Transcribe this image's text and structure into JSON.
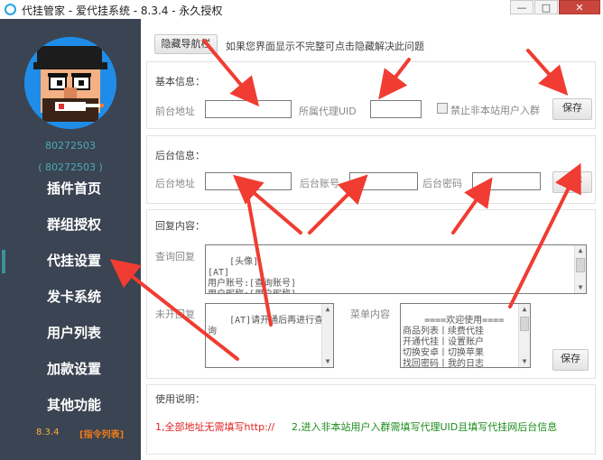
{
  "window": {
    "title": "代挂管家 - 爱代挂系统 - 8.3.4 - 永久授权",
    "min_label": "—",
    "max_label": "□",
    "close_label": "✕"
  },
  "sidebar": {
    "uid_primary": "80272503",
    "uid_secondary": "( 80272503 )",
    "items": [
      {
        "label": "插件首页"
      },
      {
        "label": "群组授权"
      },
      {
        "label": "代挂设置"
      },
      {
        "label": "发卡系统"
      },
      {
        "label": "用户列表"
      },
      {
        "label": "加款设置"
      },
      {
        "label": "其他功能"
      }
    ],
    "active_index": 2,
    "version": "8.3.4",
    "cmd_list": "[指令列表]"
  },
  "top": {
    "hide_nav_button": "隐藏导航栏",
    "hint": "如果您界面显示不完整可点击隐藏解决此问题"
  },
  "basic": {
    "title": "基本信息：",
    "frontend_label": "前台地址",
    "frontend_value": "",
    "agent_uid_label": "所属代理UID",
    "agent_uid_value": "",
    "forbid_label": "禁止非本站用户入群",
    "forbid_checked": false,
    "save_label": "保存"
  },
  "backend": {
    "title": "后台信息：",
    "address_label": "后台地址",
    "address_value": "",
    "account_label": "后台账号",
    "account_value": "",
    "password_label": "后台密码",
    "password_value": "",
    "save_label": "保存"
  },
  "reply": {
    "title": "回复内容：",
    "query_label": "查询回复",
    "query_value": "[头像]\n[AT]\n用户账号:[查询账号]\n用户昵称:[用户昵称]",
    "unopened_label": "未开回复",
    "unopened_value": "[AT]请开通后再进行查\n询",
    "menu_label": "菜单内容",
    "menu_value": "====欢迎使用====\n商品列表丨续费代挂\n开通代挂丨设置账户\n切换安卓丨切换苹果\n找回密码丨我的日志",
    "save_label": "保存"
  },
  "usage": {
    "title": "使用说明：",
    "note_red": "1,全部地址无需填写http://",
    "note_green": "2,进入非本站用户入群需填写代理UID且填写代挂网后台信息"
  },
  "colors": {
    "sidebar_bg": "#3a4452",
    "accent_blue": "#29a3e0",
    "arrow_red": "#f03c32",
    "uid_teal": "#4ea9b8",
    "version_orange": "#ffae3a",
    "note_red": "#e02222",
    "note_green": "#1b8b1b"
  }
}
